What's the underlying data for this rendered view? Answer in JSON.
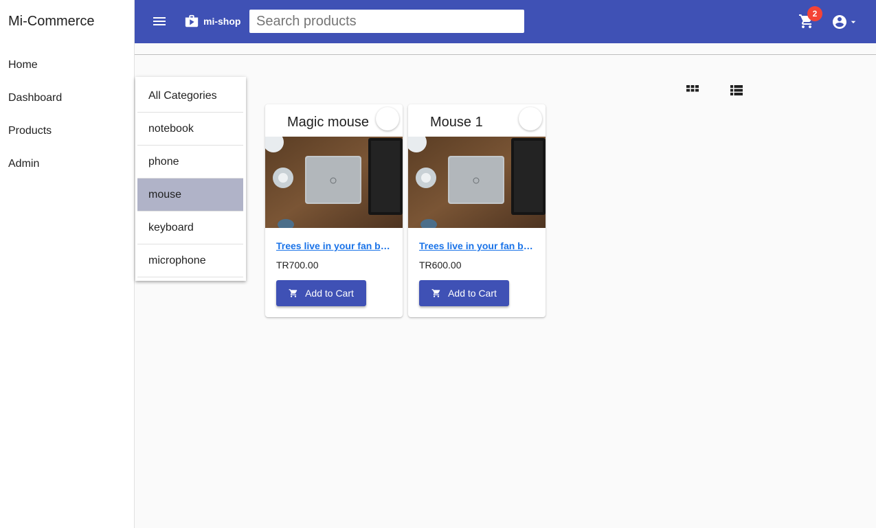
{
  "sidebar": {
    "brand": "Mi-Commerce",
    "items": [
      {
        "label": "Home"
      },
      {
        "label": "Dashboard"
      },
      {
        "label": "Products"
      },
      {
        "label": "Admin"
      }
    ]
  },
  "toolbar": {
    "menu_icon": "hamburger-menu-icon",
    "shop_label": "mi-shop",
    "shop_icon": "shop-bag-icon",
    "search_placeholder": "Search products",
    "cart_count": "2",
    "cart_icon": "shopping-cart-icon",
    "account_icon": "account-circle-icon",
    "colors": {
      "primary": "#3f51b5",
      "badge": "#f44336"
    }
  },
  "categories": {
    "items": [
      {
        "label": "All Categories"
      },
      {
        "label": "notebook"
      },
      {
        "label": "phone"
      },
      {
        "label": "mouse"
      },
      {
        "label": "keyboard"
      },
      {
        "label": "microphone"
      }
    ],
    "selected": "mouse"
  },
  "view_toggle": {
    "grid_icon": "grid-view-icon",
    "list_icon": "list-view-icon"
  },
  "products": [
    {
      "title": "Magic mouse",
      "description": "Trees live in your fan brush",
      "price": "TR700.00",
      "add_label": "Add to Cart"
    },
    {
      "title": "Mouse 1",
      "description": "Trees live in your fan brush",
      "price": "TR600.00",
      "add_label": "Add to Cart"
    }
  ]
}
